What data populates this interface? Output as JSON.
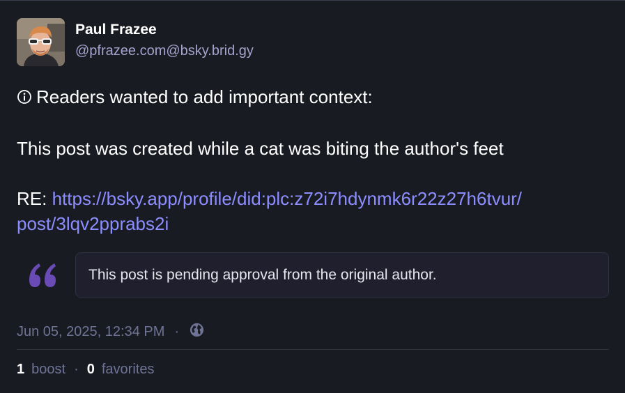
{
  "author": {
    "display_name": "Paul Frazee",
    "account": "@pfrazee.com@bsky.brid.gy",
    "avatar": "avatar-photo"
  },
  "content": {
    "info_icon": "info-circle-icon",
    "context_line": "Readers wanted to add important context:",
    "body_line": "This post was created while a cat was biting the author's feet",
    "re_prefix": "RE: ",
    "re_link_line1": "https://bsky.app/profile/did:plc:z72i7hdynmk6r22z27h6tvur/",
    "re_link_line2": "post/3lqv2pprabs2i"
  },
  "quote": {
    "icon": "quote-mark-icon",
    "text": "This post is pending approval from the original author."
  },
  "meta": {
    "timestamp": "Jun 05, 2025, 12:34 PM",
    "separator": "·",
    "visibility_icon": "globe-icon"
  },
  "stats": {
    "boost_count": "1",
    "boost_label": "boost",
    "separator": "·",
    "favorites_count": "0",
    "favorites_label": "favorites"
  },
  "colors": {
    "background": "#191b22",
    "link": "#8c8dff",
    "accent_purple": "#6a4bb5",
    "muted": "#6f7396"
  }
}
